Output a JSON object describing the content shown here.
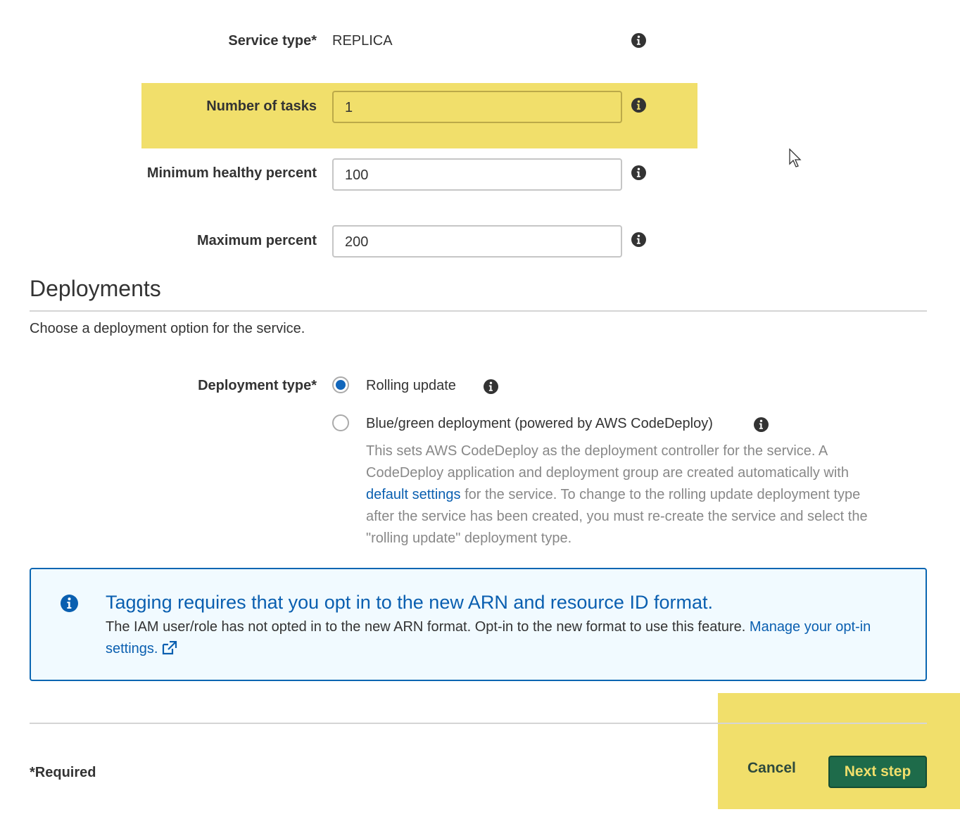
{
  "form": {
    "service_type": {
      "label": "Service type*",
      "value": "REPLICA"
    },
    "number_of_tasks": {
      "label": "Number of tasks",
      "value": "1"
    },
    "min_healthy_percent": {
      "label": "Minimum healthy percent",
      "value": "100"
    },
    "max_percent": {
      "label": "Maximum percent",
      "value": "200"
    }
  },
  "deployments": {
    "heading": "Deployments",
    "description": "Choose a deployment option for the service.",
    "type_label": "Deployment type*",
    "options": [
      {
        "label": "Rolling update",
        "checked": true
      },
      {
        "label": "Blue/green deployment (powered by AWS CodeDeploy)",
        "checked": false
      }
    ],
    "bluegreen_desc": {
      "part1": "This sets AWS CodeDeploy as the deployment controller for the service. A CodeDeploy application and deployment group are created automatically with ",
      "link": "default settings",
      "part2": " for the service. To change to the rolling update deployment type after the service has been created, you must re-create the service and select the \"rolling update\" deployment type."
    }
  },
  "alert": {
    "title": "Tagging requires that you opt in to the new ARN and resource ID format.",
    "body": "The IAM user/role has not opted in to the new ARN format. Opt-in to the new format to use this feature. ",
    "link": "Manage your opt-in settings."
  },
  "footer": {
    "required_note": "*Required",
    "cancel_label": "Cancel",
    "next_label": "Next step"
  },
  "colors": {
    "highlight": "#f1df6b",
    "primary_button": "#1e6b4a",
    "link": "#0a5fb0",
    "radio_selected": "#1166bb"
  },
  "icons": [
    "info-icon",
    "external-link-icon",
    "cursor-arrow-icon"
  ]
}
